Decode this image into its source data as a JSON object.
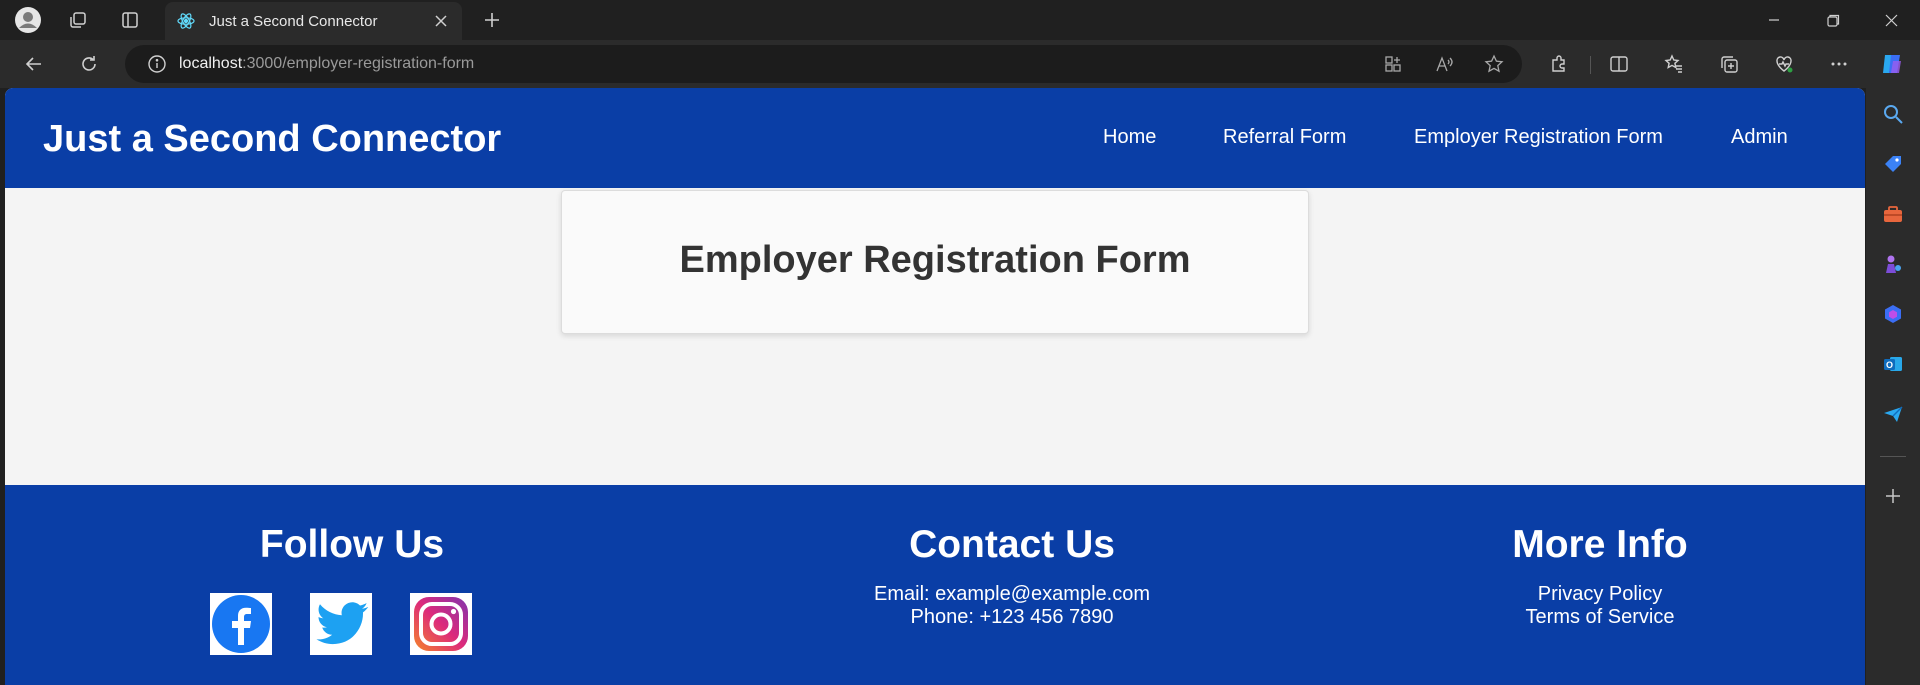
{
  "browser": {
    "tab_title": "Just a Second Connector",
    "url_host": "localhost",
    "url_rest": ":3000/employer-registration-form"
  },
  "site": {
    "brand": "Just a Second Connector",
    "nav": [
      "Home",
      "Referral Form",
      "Employer Registration Form",
      "Admin"
    ],
    "accent_color": "#0a3ea6"
  },
  "main": {
    "heading": "Employer Registration Form"
  },
  "footer": {
    "follow": {
      "title": "Follow Us",
      "icons": [
        "facebook-icon",
        "twitter-icon",
        "instagram-icon"
      ]
    },
    "contact": {
      "title": "Contact Us",
      "email": "Email: example@example.com",
      "phone": "Phone: +123 456 7890"
    },
    "more": {
      "title": "More Info",
      "links": [
        "Privacy Policy",
        "Terms of Service"
      ]
    }
  }
}
